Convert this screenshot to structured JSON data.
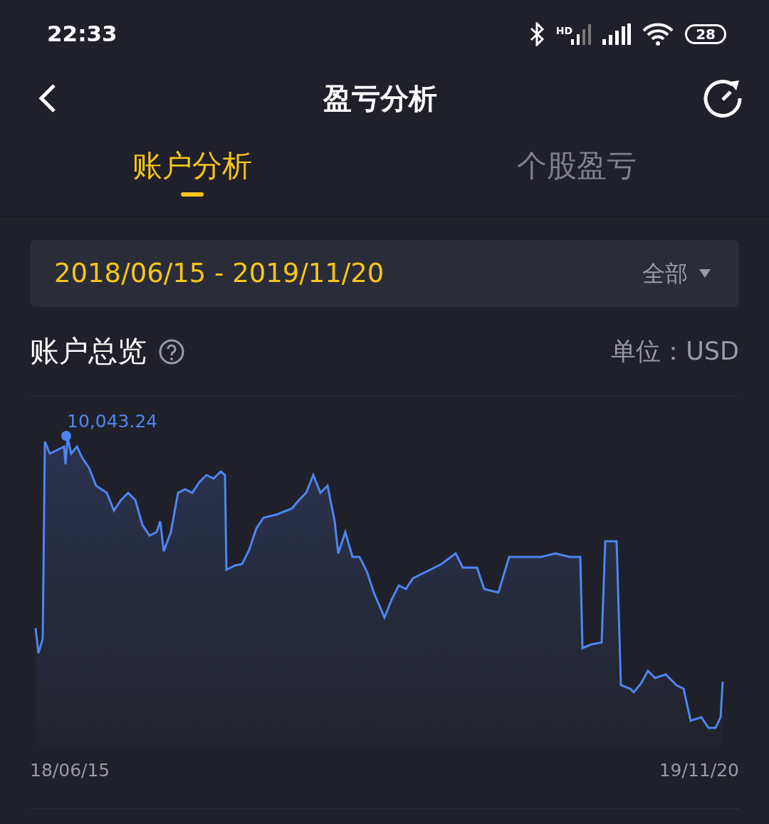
{
  "status_bar": {
    "time": "22:33",
    "network_label": "HD",
    "battery": "28"
  },
  "header": {
    "title": "盈亏分析"
  },
  "tabs": [
    {
      "label": "账户分析",
      "selected": true
    },
    {
      "label": "个股盈亏",
      "selected": false
    }
  ],
  "date_range": {
    "value": "2018/06/15 - 2019/11/20",
    "filter": "全部"
  },
  "overview": {
    "title": "账户总览",
    "unit": "单位：USD",
    "peak_label": "10,043.24",
    "start_date": "18/06/15",
    "end_date": "19/11/20"
  }
}
